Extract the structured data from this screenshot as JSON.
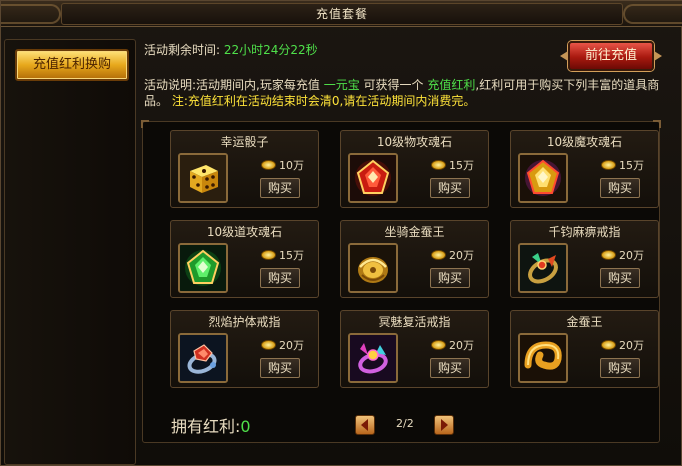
{
  "window": {
    "title": "充值套餐"
  },
  "sidebar": {
    "tab_label": "充值红利换购"
  },
  "header": {
    "timer_label": "活动剩余时间:",
    "timer_value": "22小时24分22秒",
    "recharge_button": "前往充值"
  },
  "description": {
    "label": "活动说明",
    "line_part1": ":活动期间内,玩家每充值",
    "currency": "一元宝",
    "line_part2": "可获得一个",
    "bonus_name": "充值红利",
    "line_part3": ",红利可用于购买下列丰富的道具商品。",
    "note": "注:充值红利在活动结束时会清0,请在活动期间内消费完。"
  },
  "shop": {
    "buy_label": "购买",
    "items": [
      {
        "name": "幸运骰子",
        "price": "10万",
        "icon": "dice-icon"
      },
      {
        "name": "10级物攻魂石",
        "price": "15万",
        "icon": "red-soulstone-icon"
      },
      {
        "name": "10级魔攻魂石",
        "price": "15万",
        "icon": "gold-soulstone-icon"
      },
      {
        "name": "10级道攻魂石",
        "price": "15万",
        "icon": "green-soulstone-icon"
      },
      {
        "name": "坐骑金蚕王",
        "price": "20万",
        "icon": "golden-silkworm-mount-icon"
      },
      {
        "name": "千钧麻痹戒指",
        "price": "20万",
        "icon": "paralysis-ring-icon"
      },
      {
        "name": "烈焰护体戒指",
        "price": "20万",
        "icon": "flame-guard-ring-icon"
      },
      {
        "name": "冥魅复活戒指",
        "price": "20万",
        "icon": "revive-ring-icon"
      },
      {
        "name": "金蚕王",
        "price": "20万",
        "icon": "golden-silkworm-icon"
      }
    ]
  },
  "footer": {
    "bonus_label": "拥有红利:",
    "bonus_value": "0",
    "page_indicator": "2/2"
  },
  "colors": {
    "highlight_green": "#4fe04a",
    "note_yellow": "#ffe43a",
    "gold_tab": "#e7a81c",
    "red_button": "#a8190f"
  }
}
